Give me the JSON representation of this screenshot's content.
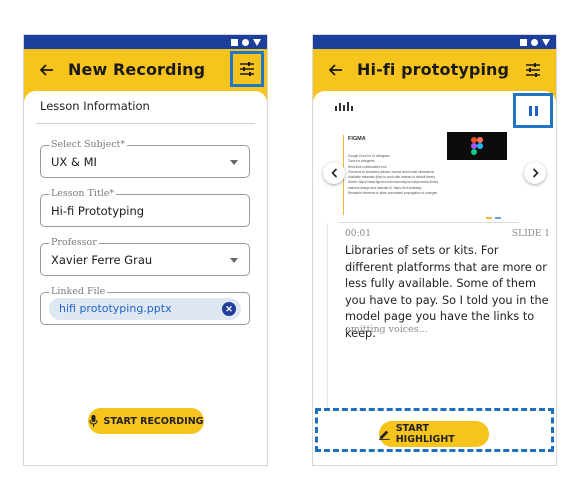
{
  "left": {
    "title": "New Recording",
    "section": "Lesson Information",
    "fields": [
      {
        "label": "Select Subject*",
        "value": "UX & MI",
        "type": "select"
      },
      {
        "label": "Lesson Title*",
        "value": "Hi-fi Prototyping",
        "type": "text"
      },
      {
        "label": "Professor",
        "value": "Xavier Ferre Grau",
        "type": "select"
      },
      {
        "label": "Linked File",
        "value": "hifi prototyping.pptx",
        "type": "file"
      }
    ],
    "button": "START RECORDING"
  },
  "right": {
    "title": "Hi-fi prototyping",
    "slide": {
      "title": "FIGMA",
      "bullets": [
        "Google Docs for UI designers",
        "Tools for designers",
        "Real-time collaborative tool",
        "Overview to simulate judicious mouse and modal interactions",
        "Available materials (kits) to work with instead of default library",
        "Article: https://www.figma.com/community/ui-components-library",
        "material design and material UI: https://m3.io/design",
        "Reusable elements to allow automated propagation of changes"
      ]
    },
    "time": "00:01",
    "slide_label": "SLIDE 1",
    "transcript": "Libraries of sets or kits. For different platforms that are more or less fully available. Some of them you have to pay. So I told you in the model page you have the links to keep.",
    "omitting": "omitting voices...",
    "button": "START HIGHLIGHT"
  },
  "colors": {
    "status_bar": "#1d3f9c",
    "app_bar": "#f7c31d",
    "accent_blue": "#1f77c6",
    "chip_text": "#1f63c4"
  },
  "icons": [
    "back-arrow-icon",
    "tune-icon",
    "microphone-icon",
    "pencil-icon",
    "pause-icon",
    "waveform-icon",
    "chevron-left-icon",
    "chevron-right-icon",
    "clear-icon"
  ]
}
